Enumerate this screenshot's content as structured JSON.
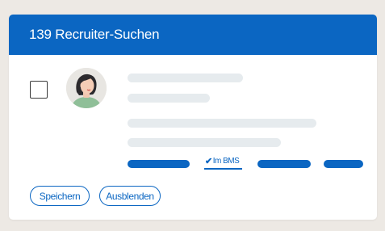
{
  "header": {
    "title": "139 Recruiter-Suchen"
  },
  "candidate": {
    "avatar_icon": "person-avatar-icon",
    "checked": false
  },
  "tags": {
    "bms_label": "Im BMS",
    "bms_icon": "check-icon"
  },
  "actions": {
    "save_label": "Speichern",
    "hide_label": "Ausblenden"
  },
  "colors": {
    "accent": "#0b66c2",
    "skeleton": "#e6ebee",
    "background": "#ede9e4"
  }
}
